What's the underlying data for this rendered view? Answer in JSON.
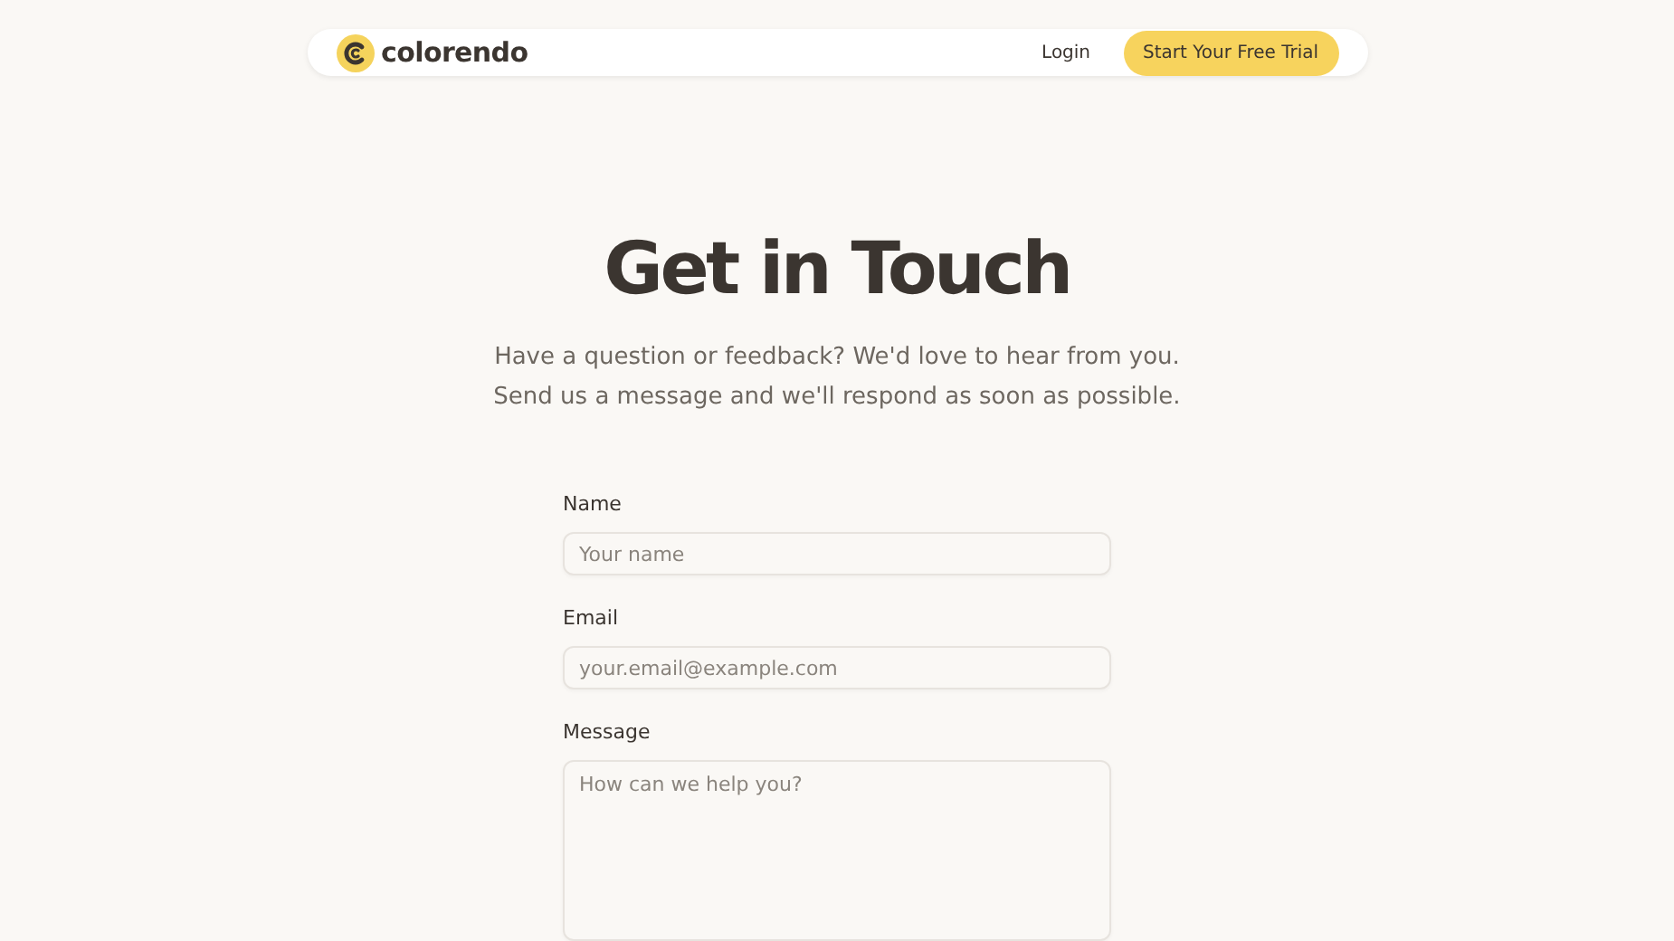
{
  "header": {
    "logo_text": "colorendo",
    "login": "Login",
    "cta": "Start Your Free Trial"
  },
  "heading": "Get in Touch",
  "intro": [
    "Have a question or feedback? We'd love to hear from you.",
    "Send us a message and we'll respond as soon as possible."
  ],
  "form": {
    "fields": [
      {
        "kind": "text",
        "label": "Name",
        "placeholder": "Your name"
      },
      {
        "kind": "email",
        "label": "Email",
        "placeholder": "your.email@example.com"
      },
      {
        "kind": "textarea",
        "label": "Message",
        "placeholder": "How can we help you?"
      }
    ]
  }
}
